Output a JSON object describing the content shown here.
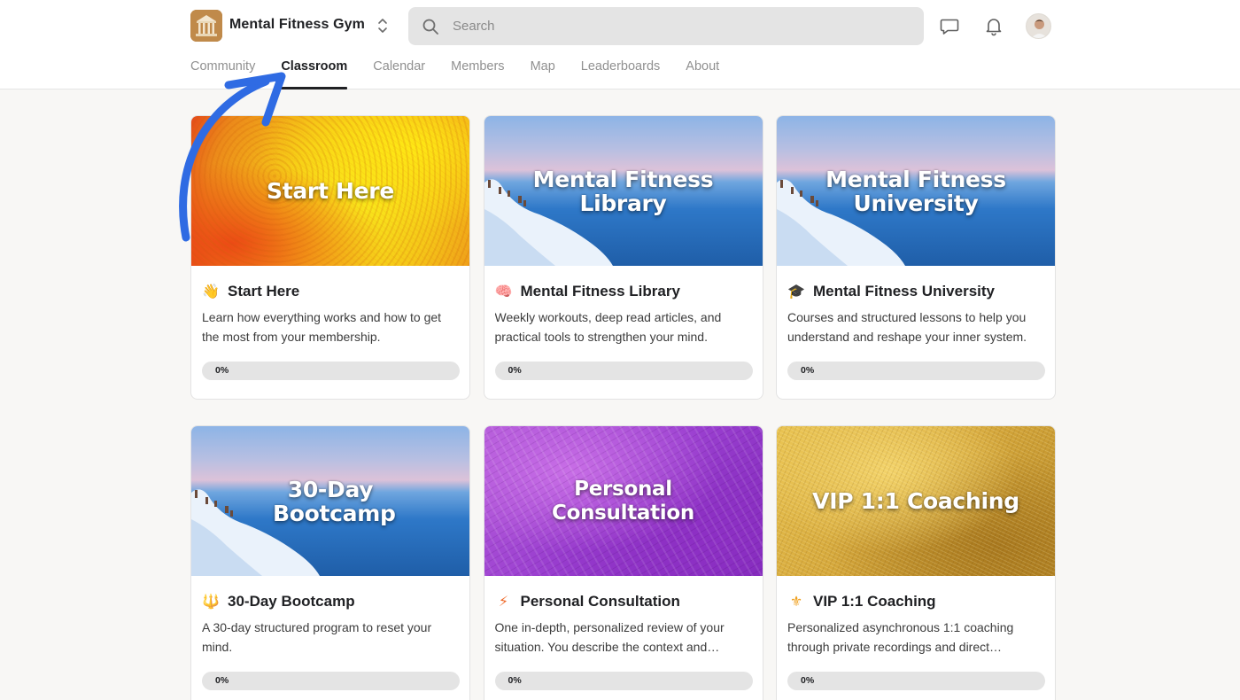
{
  "header": {
    "group_name": "Mental Fitness Gym",
    "search_placeholder": "Search"
  },
  "nav": {
    "tabs": [
      {
        "label": "Community",
        "active": false
      },
      {
        "label": "Classroom",
        "active": true
      },
      {
        "label": "Calendar",
        "active": false
      },
      {
        "label": "Members",
        "active": false
      },
      {
        "label": "Map",
        "active": false
      },
      {
        "label": "Leaderboards",
        "active": false
      },
      {
        "label": "About",
        "active": false
      }
    ]
  },
  "icons": {
    "logo": "greek-temple-icon",
    "switcher": "chevron-up-down-icon",
    "search": "search-icon",
    "chat": "chat-icon",
    "notifications": "bell-icon",
    "avatar": "avatar"
  },
  "colors": {
    "accent_arrow": "#2f6be3",
    "active_tab": "#202124",
    "inactive_tab": "#909090",
    "page_bg": "#f8f7f5"
  },
  "courses": [
    {
      "cover_text": "Start Here",
      "cover_style": "yellow",
      "emoji": "👋",
      "emoji_name": "waving-hand-icon",
      "title": "Start Here",
      "description": "Learn how everything works and how to get the most from your membership.",
      "progress": 0,
      "progress_label": "0%"
    },
    {
      "cover_text": "Mental Fitness Library",
      "cover_style": "sea",
      "emoji": "🧠",
      "emoji_name": "brain-icon",
      "title": "Mental Fitness Library",
      "description": "Weekly workouts, deep read articles, and practical tools to strengthen your mind.",
      "progress": 0,
      "progress_label": "0%"
    },
    {
      "cover_text": "Mental Fitness University",
      "cover_style": "sea",
      "emoji": "🎓",
      "emoji_name": "graduation-cap-icon",
      "title": "Mental Fitness University",
      "description": "Courses and structured lessons to help you understand and reshape your inner system.",
      "progress": 0,
      "progress_label": "0%"
    },
    {
      "cover_text": "30-Day Bootcamp",
      "cover_style": "sea",
      "emoji": "🔱",
      "emoji_name": "trident-icon",
      "title": "30-Day Bootcamp",
      "description": "A 30-day structured program to reset your mind.",
      "progress": 0,
      "progress_label": "0%"
    },
    {
      "cover_text": "Personal Consultation",
      "cover_style": "purple",
      "emoji": "⚡",
      "emoji_name": "lightning-icon",
      "title": "Personal Consultation",
      "description": "One in-depth, personalized review of your situation. You describe the context and…",
      "progress": 0,
      "progress_label": "0%"
    },
    {
      "cover_text": "VIP 1:1 Coaching",
      "cover_style": "gold",
      "emoji": "⚜",
      "emoji_name": "fleur-de-lis-icon",
      "title": "VIP 1:1 Coaching",
      "description": "Personalized asynchronous 1:1 coaching through private recordings and direct…",
      "progress": 0,
      "progress_label": "0%"
    }
  ]
}
